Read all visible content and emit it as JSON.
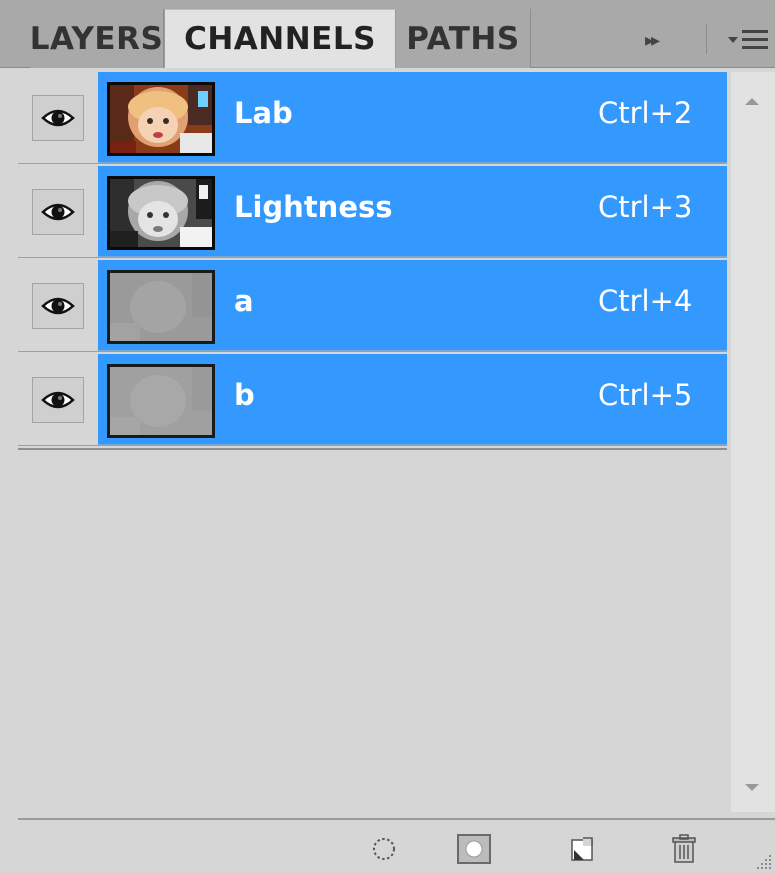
{
  "tabs": [
    {
      "label": "LAYERS",
      "active": false
    },
    {
      "label": "CHANNELS",
      "active": true
    },
    {
      "label": "PATHS",
      "active": false
    }
  ],
  "tabbar": {
    "collapse_glyph": "▸▸",
    "menu_icon": "panel-menu-icon"
  },
  "channels": [
    {
      "name": "Lab",
      "shortcut": "Ctrl+2",
      "visible": true,
      "selected": true
    },
    {
      "name": "Lightness",
      "shortcut": "Ctrl+3",
      "visible": true,
      "selected": true
    },
    {
      "name": "a",
      "shortcut": "Ctrl+4",
      "visible": true,
      "selected": true
    },
    {
      "name": "b",
      "shortcut": "Ctrl+5",
      "visible": true,
      "selected": true
    }
  ],
  "footer": {
    "icons": [
      "load-selection-icon",
      "save-selection-icon",
      "new-channel-icon",
      "delete-channel-icon"
    ]
  },
  "colors": {
    "selection": "#3399ff",
    "panel_bg": "#d6d6d6",
    "tabbar_bg": "#a9a9a9"
  }
}
